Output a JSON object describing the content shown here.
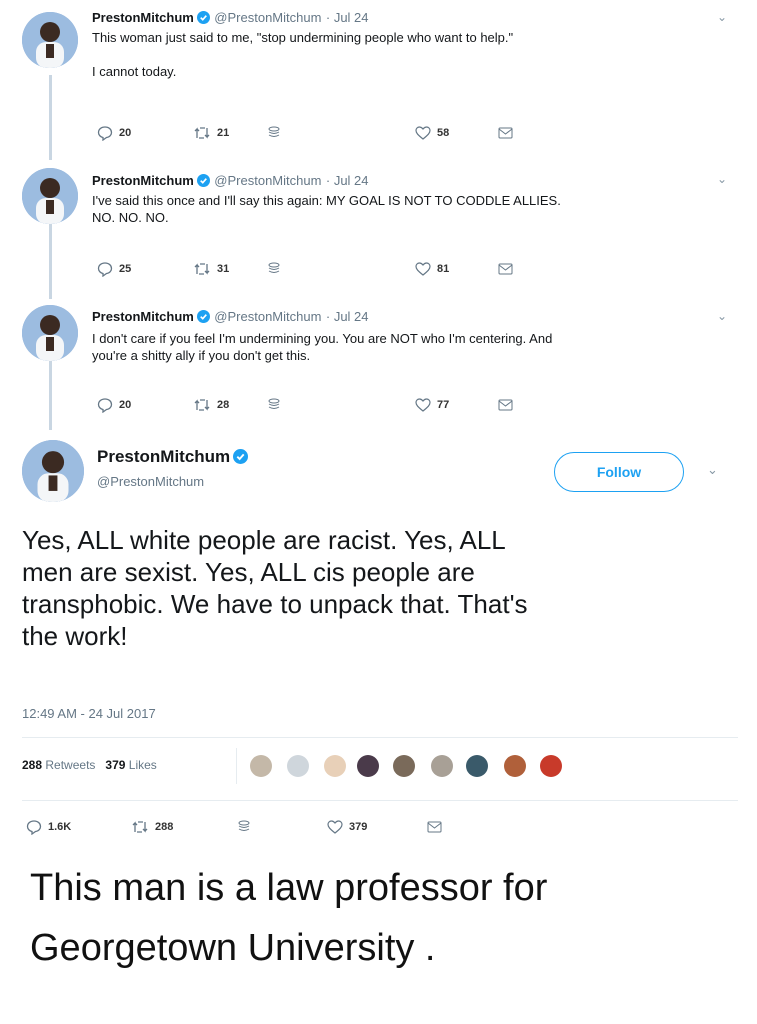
{
  "tweets": [
    {
      "name": "PrestonMitchum",
      "handle": "@PrestonMitchum",
      "date": "Jul 24",
      "lines": [
        "This woman just said to me, \"stop undermining people who want to help.\"",
        "",
        "I cannot today."
      ],
      "replies": "20",
      "retweets": "21",
      "likes": "58"
    },
    {
      "name": "PrestonMitchum",
      "handle": "@PrestonMitchum",
      "date": "Jul 24",
      "lines": [
        "I've said this once and I'll say this again: MY GOAL IS NOT TO CODDLE ALLIES.",
        "NO. NO. NO."
      ],
      "replies": "25",
      "retweets": "31",
      "likes": "81"
    },
    {
      "name": "PrestonMitchum",
      "handle": "@PrestonMitchum",
      "date": "Jul 24",
      "lines": [
        "I don't care if you feel I'm undermining you. You are NOT who I'm centering. And",
        "you're a shitty ally if you don't get this."
      ],
      "replies": "20",
      "retweets": "28",
      "likes": "77"
    }
  ],
  "main_tweet": {
    "name": "PrestonMitchum",
    "handle": "@PrestonMitchum",
    "follow_label": "Follow",
    "lines": [
      "Yes, ALL white people are racist. Yes, ALL",
      "men are sexist. Yes, ALL cis people are",
      "transphobic. We have to unpack that. That's",
      "the work!"
    ],
    "timestamp": "12:49 AM - 24 Jul 2017",
    "retweet_count": "288",
    "retweet_word": "Retweets",
    "like_count": "379",
    "like_word": "Likes",
    "replies": "1.6K",
    "retweets": "288",
    "likes": "379"
  },
  "caption": [
    "This man is a law professor for",
    "Georgetown University ."
  ],
  "colors": {
    "blue": "#1da1f2",
    "gray": "#657786",
    "text": "#14171a"
  }
}
